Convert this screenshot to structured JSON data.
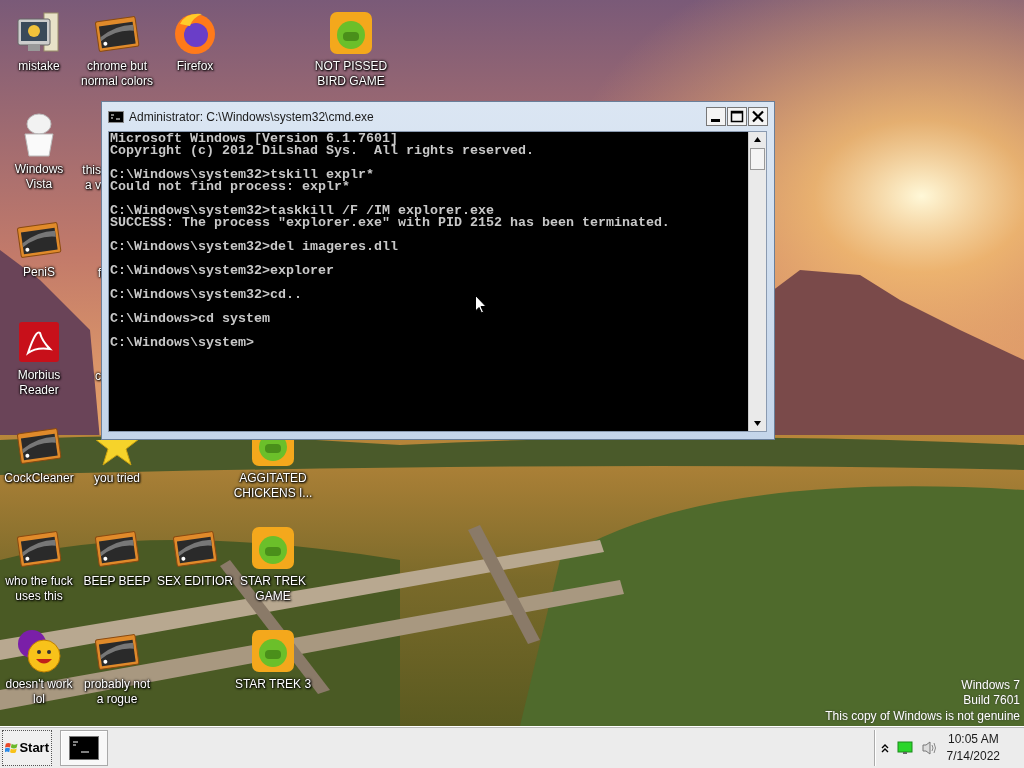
{
  "desktop": {
    "icon_rows": [
      [
        {
          "kind": "computer",
          "lines": [
            "mistake"
          ]
        },
        {
          "kind": "app-window",
          "lines": [
            "chrome but",
            "normal colors"
          ]
        },
        {
          "kind": "browser",
          "lines": [
            "Firefox"
          ]
        },
        null,
        {
          "kind": "game",
          "lines": [
            "NOT PISSED",
            "BIRD GAME"
          ]
        }
      ],
      [
        {
          "kind": "jar",
          "lines": [
            "Windows",
            "Vista"
          ]
        },
        {
          "kind": "covered",
          "lines": [
            "this",
            "a v"
          ]
        }
      ],
      [
        {
          "kind": "app-window",
          "lines": [
            "PeniS"
          ]
        },
        {
          "kind": "covered",
          "lines": [
            "f"
          ]
        }
      ],
      [
        {
          "kind": "document",
          "lines": [
            "Morbius",
            "Reader"
          ]
        },
        {
          "kind": "covered",
          "lines": [
            "c"
          ]
        }
      ],
      [
        {
          "kind": "app-window",
          "lines": [
            "CockCleaner"
          ]
        },
        {
          "kind": "star",
          "lines": [
            "you tried"
          ]
        },
        null,
        {
          "kind": "game",
          "lines": [
            "AGGITATED",
            "CHICKENS I..."
          ]
        }
      ],
      [
        {
          "kind": "app-window",
          "lines": [
            "who the fuck",
            "uses this"
          ]
        },
        {
          "kind": "app-window",
          "lines": [
            "BEEP BEEP"
          ]
        },
        {
          "kind": "app-window",
          "lines": [
            "SEX EDITIOR"
          ]
        },
        {
          "kind": "game",
          "lines": [
            "STAR TREK",
            "GAME"
          ]
        }
      ],
      [
        {
          "kind": "smiley",
          "lines": [
            "doesn't work",
            "lol"
          ]
        },
        {
          "kind": "app-window",
          "lines": [
            "probably not",
            "a rogue"
          ]
        },
        null,
        {
          "kind": "game",
          "lines": [
            "STAR TREK 3"
          ]
        }
      ]
    ],
    "watermark": [
      "Windows 7",
      "Build 7601",
      "This copy of Windows is not genuine"
    ]
  },
  "console_window": {
    "title": "Administrator: C:\\Windows\\system32\\cmd.exe",
    "blocks": [
      [
        "Microsoft Windows [Version 6.1.7601]",
        "Copyright (c) 2012 DiLshad Sys.  All rights reserved."
      ],
      [
        "C:\\Windows\\system32>tskill explr*",
        "Could not find process: explr*"
      ],
      [
        "C:\\Windows\\system32>taskkill /F /IM explorer.exe",
        "SUCCESS: The process \"explorer.exe\" with PID 2152 has been terminated."
      ],
      [
        "C:\\Windows\\system32>del imageres.dll"
      ],
      [
        "C:\\Windows\\system32>explorer"
      ],
      [
        "C:\\Windows\\system32>cd.."
      ],
      [
        "C:\\Windows>cd system"
      ],
      [
        "C:\\Windows\\system>"
      ]
    ]
  },
  "taskbar": {
    "start": "Start",
    "tasks": [
      {
        "kind": "console"
      }
    ],
    "clock": {
      "time": "10:05 AM",
      "date": "7/14/2022"
    }
  }
}
